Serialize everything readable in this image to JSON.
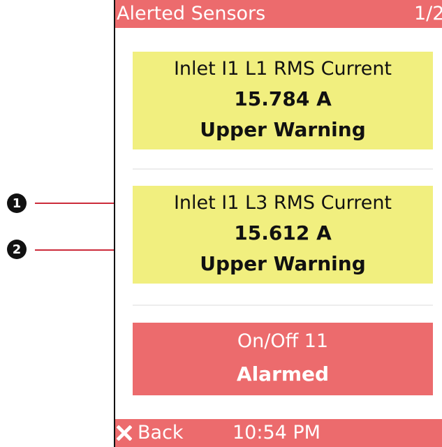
{
  "header": {
    "title": "Alerted Sensors",
    "page_indicator": "1/2"
  },
  "sensors": [
    {
      "name": "Inlet I1 L1 RMS Current",
      "value": "15.784 A",
      "state": "Upper Warning",
      "status_color": "#f1ef7f"
    },
    {
      "name": "Inlet I1 L3 RMS Current",
      "value": "15.612 A",
      "state": "Upper Warning",
      "status_color": "#f1ef7f"
    },
    {
      "name": "On/Off 11",
      "value": "",
      "state": "Alarmed",
      "status_color": "#ec6b6d"
    }
  ],
  "annotations": [
    {
      "label": "1"
    },
    {
      "label": "2"
    }
  ],
  "footer": {
    "back_label": "Back",
    "back_icon": "close-icon",
    "time": "10:54 PM"
  },
  "colors": {
    "accent": "#ec6b6d",
    "warning": "#f1ef7f",
    "callout": "#cc2b3a"
  }
}
